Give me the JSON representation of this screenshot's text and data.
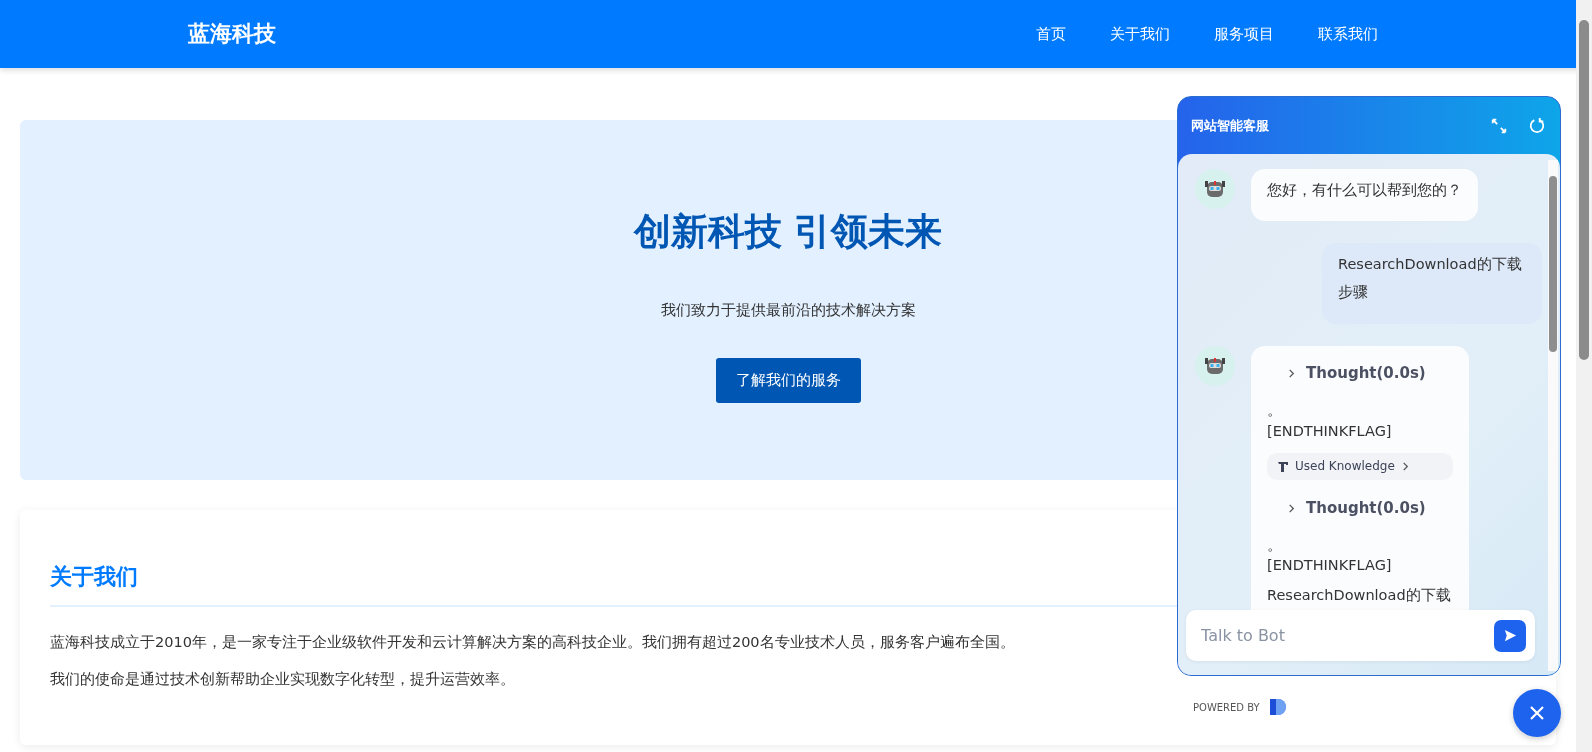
{
  "navbar": {
    "brand": "蓝海科技",
    "links": [
      {
        "label": "首页"
      },
      {
        "label": "关于我们"
      },
      {
        "label": "服务项目"
      },
      {
        "label": "联系我们"
      }
    ]
  },
  "hero": {
    "title": "创新科技 引领未来",
    "subtitle": "我们致力于提供最前沿的技术解决方案",
    "button": "了解我们的服务"
  },
  "about": {
    "heading": "关于我们",
    "paragraphs": [
      "蓝海科技成立于2010年，是一家专注于企业级软件开发和云计算解决方案的高科技企业。我们拥有超过200名专业技术人员，服务客户遍布全国。",
      "我们的使命是通过技术创新帮助企业实现数字化转型，提升运营效率。"
    ]
  },
  "chat": {
    "title": "网站智能客服",
    "messages": [
      {
        "kind": "bot",
        "blocks": [
          {
            "kind": "text",
            "lines": [
              "您好，有什么可以帮到您的？"
            ]
          }
        ]
      },
      {
        "kind": "user",
        "blocks": [
          {
            "kind": "text",
            "lines": [
              "ResearchDownload的下载步骤"
            ]
          }
        ]
      },
      {
        "kind": "bot",
        "blocks": [
          {
            "kind": "thought",
            "label": "Thought(0.0s)"
          },
          {
            "kind": "text",
            "lines": [
              "。",
              "[ENDTHINKFLAG]"
            ]
          },
          {
            "kind": "knowledge",
            "label": "Used Knowledge"
          },
          {
            "kind": "thought",
            "label": "Thought(0.0s)"
          },
          {
            "kind": "text",
            "lines": [
              "。",
              "[ENDTHINKFLAG]"
            ]
          },
          {
            "kind": "text",
            "lines": [
              "ResearchDownload的下载"
            ]
          }
        ]
      }
    ],
    "input": {
      "placeholder": "Talk to Bot"
    },
    "powered_by": "POWERED BY"
  }
}
